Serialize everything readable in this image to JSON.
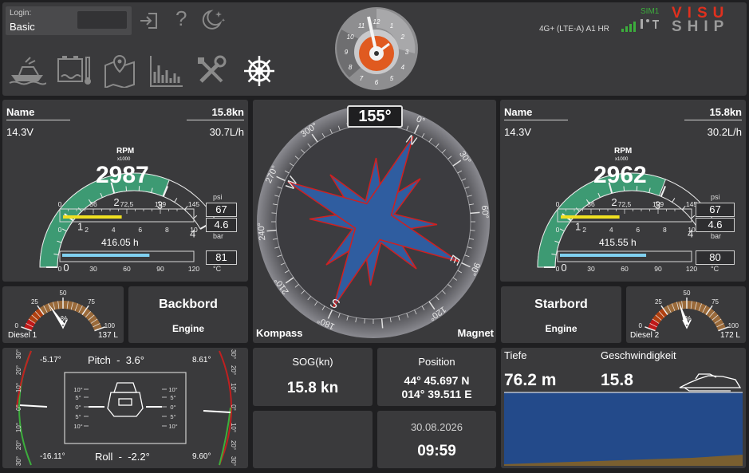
{
  "colors": {
    "bg": "#1f1f21",
    "panel": "#3a3a3c",
    "gauge_green": "#3d9a73",
    "fuel_yellow": "#f0e020",
    "temp_blue": "#7fd0f0",
    "sea_blue": "#234a8a",
    "sea_floor": "#7a5f30",
    "brand_red": "#e0301e",
    "signal_green": "#3cae3c",
    "rose_blue": "#2f5da0",
    "rose_red": "#d02020"
  },
  "header": {
    "login_label": "Login:",
    "login_value": "Basic",
    "nav_icons": [
      "boat-icon",
      "battery-icon",
      "map-icon",
      "chart-icon",
      "tools-icon",
      "helm-icon"
    ],
    "sim_label": "SIM1",
    "network": "4G+ (LTE-A) A1 HR",
    "brand_top": "VISU",
    "brand_bottom": "SHIP",
    "clock_numbers": [
      "12",
      "1",
      "2",
      "3",
      "4",
      "5",
      "6",
      "7",
      "8",
      "9",
      "10",
      "11"
    ]
  },
  "engine_port": {
    "name_label": "Name",
    "voltage": "14.3V",
    "hours_top": "15.8kn",
    "consumption": "30.7L/h",
    "rpm_label": "RPM",
    "rpm_multiplier": "x1000",
    "rpm_value": "2987",
    "rpm": 2.987,
    "rpm_scale": [
      "0",
      "1",
      "2",
      "3",
      "4"
    ],
    "psi_scale": [
      "0",
      "36",
      "72,5",
      "109",
      "145"
    ],
    "bar_scale": [
      "0",
      "2",
      "4",
      "6",
      "8",
      "10"
    ],
    "psi_unit": "psi",
    "bar_unit": "bar",
    "psi_value": "67",
    "bar_value": "4.6",
    "oil_fraction": 0.46,
    "engine_hours": "416.05 h",
    "temp_scale": [
      "0",
      "30",
      "60",
      "90",
      "120"
    ],
    "temp_value": "81",
    "temp_unit": "°C",
    "temp_fraction": 0.675
  },
  "engine_starboard": {
    "name_label": "Name",
    "voltage": "14.3V",
    "hours_top": "15.8kn",
    "consumption": "30.2L/h",
    "rpm_label": "RPM",
    "rpm_multiplier": "x1000",
    "rpm_value": "2962",
    "rpm": 2.962,
    "rpm_scale": [
      "0",
      "1",
      "2",
      "3",
      "4"
    ],
    "psi_scale": [
      "0",
      "36",
      "72,5",
      "109",
      "145"
    ],
    "bar_scale": [
      "0",
      "2",
      "4",
      "6",
      "8",
      "10"
    ],
    "psi_unit": "psi",
    "bar_unit": "bar",
    "psi_value": "67",
    "bar_value": "4.6",
    "oil_fraction": 0.46,
    "engine_hours": "415.55 h",
    "temp_scale": [
      "0",
      "30",
      "60",
      "90",
      "120"
    ],
    "temp_value": "80",
    "temp_unit": "°C",
    "temp_fraction": 0.667
  },
  "tank_port": {
    "scale": [
      "0",
      "25",
      "50",
      "75",
      "100"
    ],
    "name": "Diesel 1",
    "volume": "137 L",
    "percent_sign": "%",
    "level": 0.35
  },
  "tank_starboard": {
    "scale": [
      "0",
      "25",
      "50",
      "75",
      "100"
    ],
    "name": "Diesel 2",
    "volume": "172 L",
    "percent_sign": "%",
    "level": 0.42
  },
  "label_port": {
    "title": "Backbord",
    "subtitle": "Engine"
  },
  "label_starboard": {
    "title": "Starbord",
    "subtitle": "Engine"
  },
  "compass": {
    "heading_display": "155°",
    "heading": 155,
    "left_label": "Kompass",
    "right_label": "Magnet",
    "ticks": [
      "0°",
      "30°",
      "60°",
      "90°",
      "120°",
      "180°",
      "210°",
      "240°",
      "270°",
      "300°",
      "330°"
    ],
    "cardinals": {
      "N": "N",
      "E": "E",
      "S": "S",
      "W": "W"
    }
  },
  "attitude": {
    "pitch_label": "Pitch",
    "pitch_value": "3.6°",
    "pitch_separator": "-",
    "roll_label": "Roll",
    "roll_value": "-2.2°",
    "roll_separator": "-",
    "top_left": "-5.17°",
    "top_right": "8.61°",
    "bottom_left": "-16.11°",
    "bottom_right": "9.60°",
    "inner_scale": [
      "10°",
      "5°",
      "0°",
      "5°",
      "10°"
    ],
    "outer_scale": [
      "30°",
      "20°",
      "10°",
      "0°",
      "10°",
      "20°",
      "30°"
    ]
  },
  "sog": {
    "label": "SOG(kn)",
    "value": "15.8 kn"
  },
  "position": {
    "label": "Position",
    "lat": "44° 45.697 N",
    "lon": "014° 39.511 E"
  },
  "datetime": {
    "date": "30.08.2026",
    "time": "09:59"
  },
  "depth": {
    "depth_label": "Tiefe",
    "depth_value": "76.2 m",
    "speed_label": "Geschwindigkeit",
    "speed_value": "15.8"
  }
}
